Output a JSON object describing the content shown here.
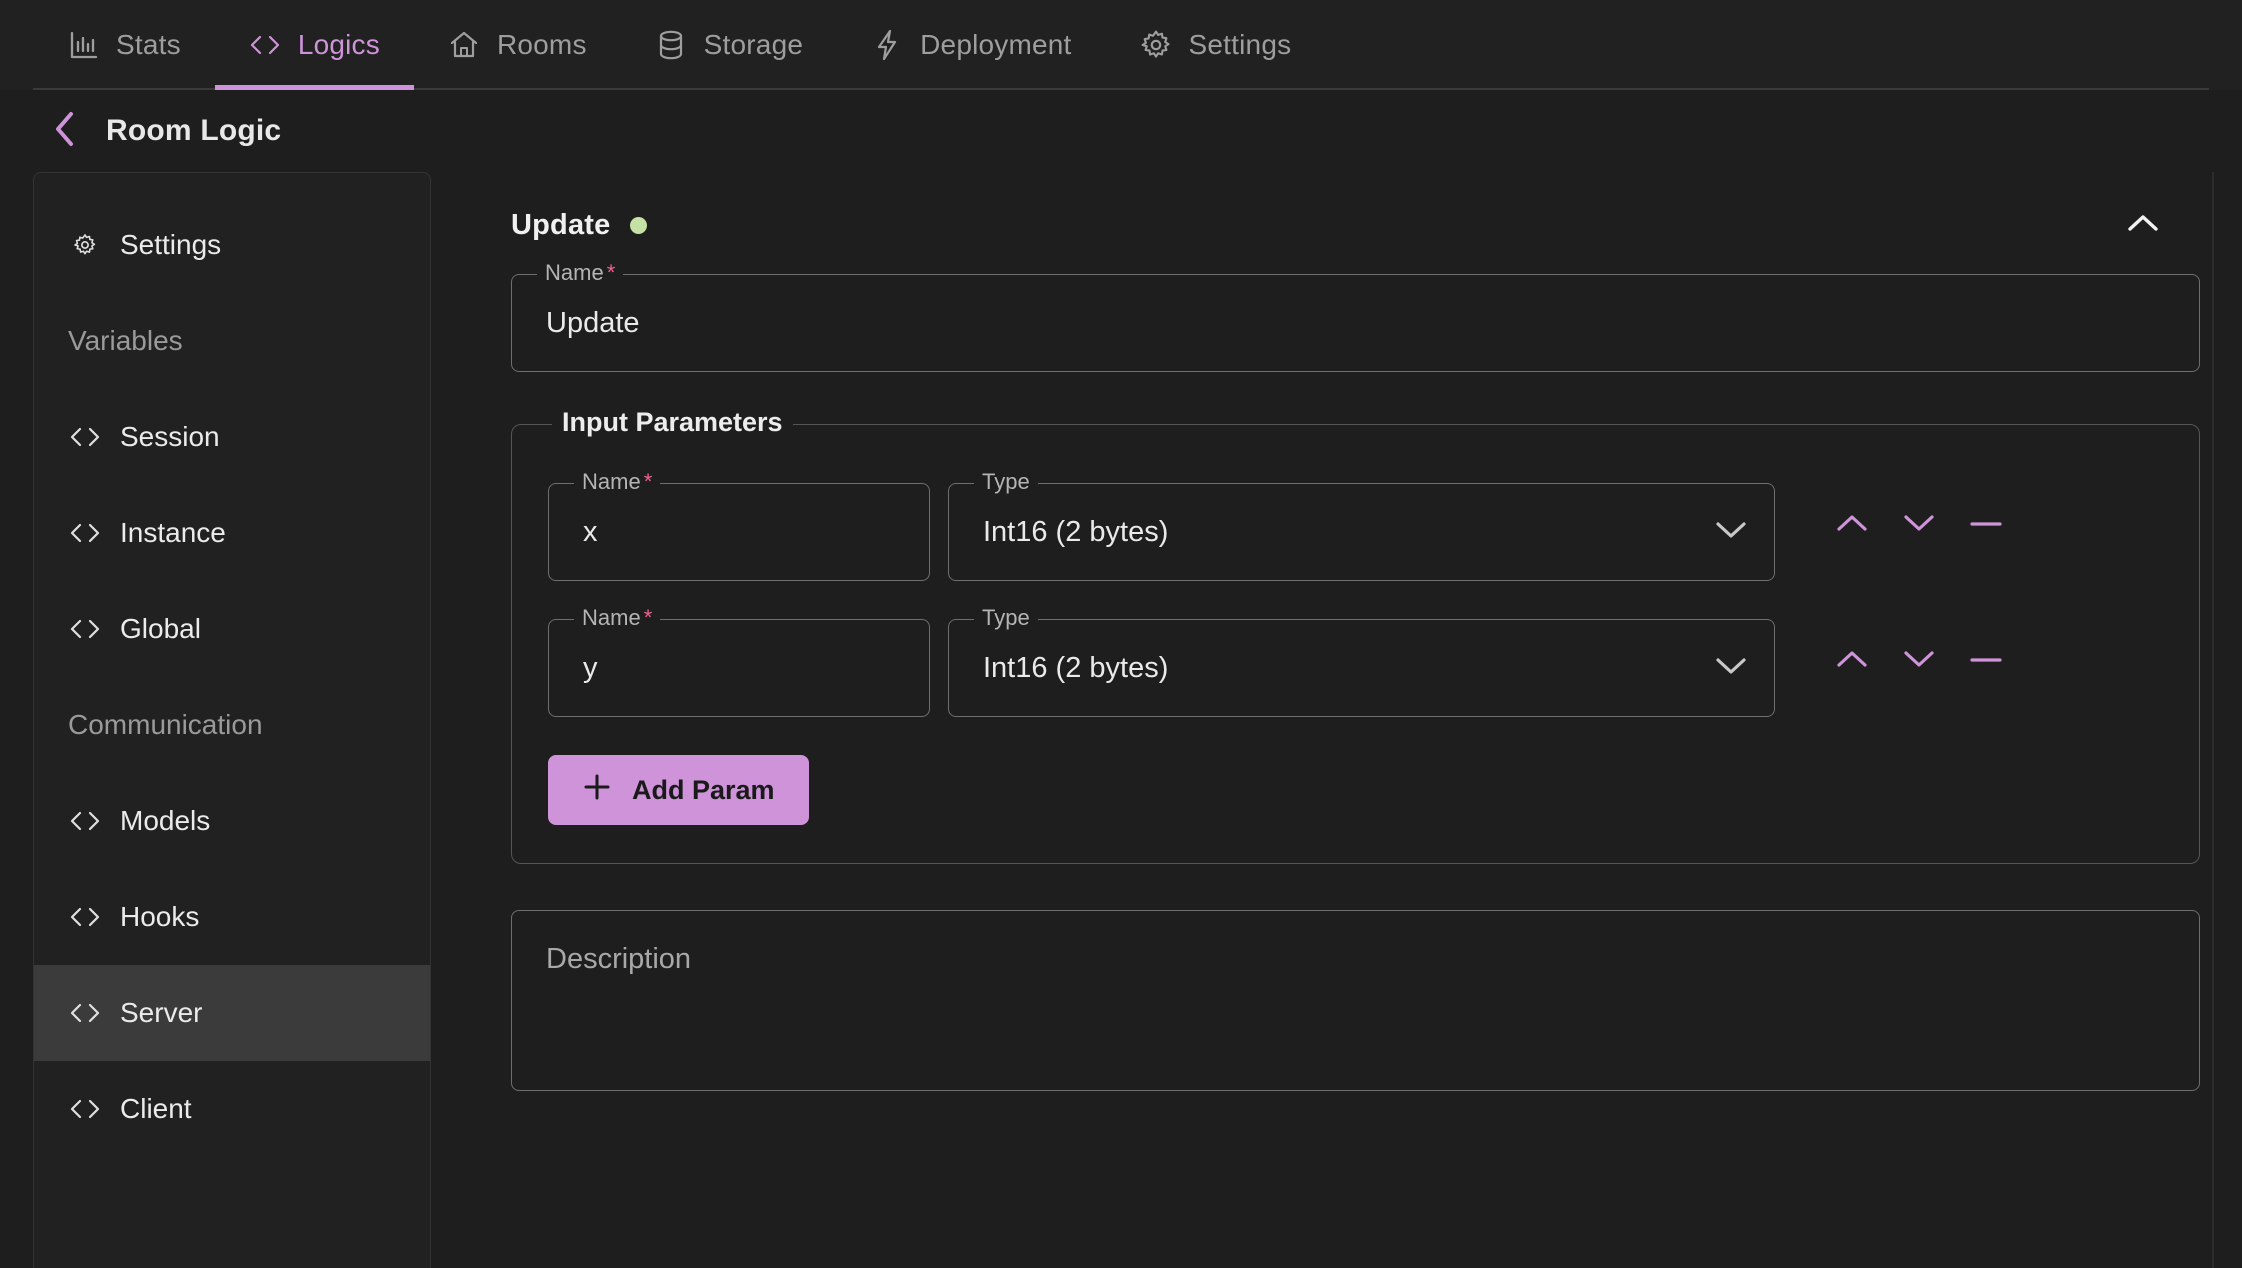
{
  "topbar": {
    "tabs": [
      {
        "label": "Stats",
        "icon": "bar-chart-icon",
        "active": false
      },
      {
        "label": "Logics",
        "icon": "code-brackets-icon",
        "active": true
      },
      {
        "label": "Rooms",
        "icon": "home-icon",
        "active": false
      },
      {
        "label": "Storage",
        "icon": "database-icon",
        "active": false
      },
      {
        "label": "Deployment",
        "icon": "lightning-bolt-icon",
        "active": false
      },
      {
        "label": "Settings",
        "icon": "gear-icon",
        "active": false
      }
    ]
  },
  "header": {
    "back_icon": "chevron-left-icon",
    "title": "Room Logic"
  },
  "sidebar": {
    "items": [
      {
        "label": "Settings",
        "icon": "gear-icon",
        "type": "item",
        "selected": false
      },
      {
        "label": "Variables",
        "icon": "",
        "type": "heading",
        "selected": false
      },
      {
        "label": "Session",
        "icon": "code-brackets-icon",
        "type": "item",
        "selected": false
      },
      {
        "label": "Instance",
        "icon": "code-brackets-icon",
        "type": "item",
        "selected": false
      },
      {
        "label": "Global",
        "icon": "code-brackets-icon",
        "type": "item",
        "selected": false
      },
      {
        "label": "Communication",
        "icon": "",
        "type": "heading",
        "selected": false
      },
      {
        "label": "Models",
        "icon": "code-brackets-icon",
        "type": "item",
        "selected": false
      },
      {
        "label": "Hooks",
        "icon": "code-brackets-icon",
        "type": "item",
        "selected": false
      },
      {
        "label": "Server",
        "icon": "code-brackets-icon",
        "type": "item",
        "selected": true
      },
      {
        "label": "Client",
        "icon": "code-brackets-icon",
        "type": "item",
        "selected": false
      }
    ]
  },
  "main": {
    "section": {
      "title": "Update",
      "status_dot_color": "#c5e1a5",
      "collapse_icon": "chevron-up-icon"
    },
    "name_field": {
      "label": "Name",
      "required": true,
      "value": "Update"
    },
    "input_parameters": {
      "legend": "Input Parameters",
      "name_label": "Name",
      "type_label": "Type",
      "name_required": true,
      "rows": [
        {
          "name": "x",
          "type": "Int16 (2 bytes)"
        },
        {
          "name": "y",
          "type": "Int16 (2 bytes)"
        }
      ],
      "row_actions": [
        {
          "icon": "chevron-up-icon",
          "name": "move-param-up-button"
        },
        {
          "icon": "chevron-down-icon",
          "name": "move-param-down-button"
        },
        {
          "icon": "minus-icon",
          "name": "remove-param-button"
        }
      ],
      "add_button": {
        "label": "Add Param",
        "icon": "plus-icon"
      }
    },
    "description": {
      "placeholder": "Description",
      "value": ""
    }
  },
  "colors": {
    "accent": "#ce93d8",
    "background": "#1e1e1e",
    "panel": "#212121",
    "selected_row": "#3b3b3b",
    "required_asterisk": "#f06292",
    "status_green": "#c5e1a5"
  }
}
